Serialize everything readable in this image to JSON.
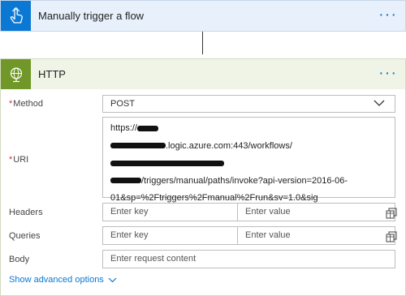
{
  "trigger": {
    "title": "Manually trigger a flow",
    "menu": "···",
    "icon": "touch-hand-icon"
  },
  "http": {
    "title": "HTTP",
    "menu": "···",
    "icon": "globe-icon",
    "method": {
      "label": "Method",
      "value": "POST"
    },
    "uri": {
      "label": "URI",
      "line1": "https://",
      "line2_suffix": ".logic.azure.com:443/workflows/",
      "line3_suffix": "/triggers/manual/paths/invoke?api-version=2016-06-",
      "line4": "01&sp=%2Ftriggers%2Fmanual%2Frun&sv=1.0&sig"
    },
    "headers": {
      "label": "Headers",
      "key_placeholder": "Enter key",
      "value_placeholder": "Enter value"
    },
    "queries": {
      "label": "Queries",
      "key_placeholder": "Enter key",
      "value_placeholder": "Enter value"
    },
    "body": {
      "label": "Body",
      "placeholder": "Enter request content"
    },
    "advanced": "Show advanced options"
  },
  "colors": {
    "accent_blue": "#0b78d4",
    "http_green": "#709727",
    "required_red": "#d13438"
  }
}
